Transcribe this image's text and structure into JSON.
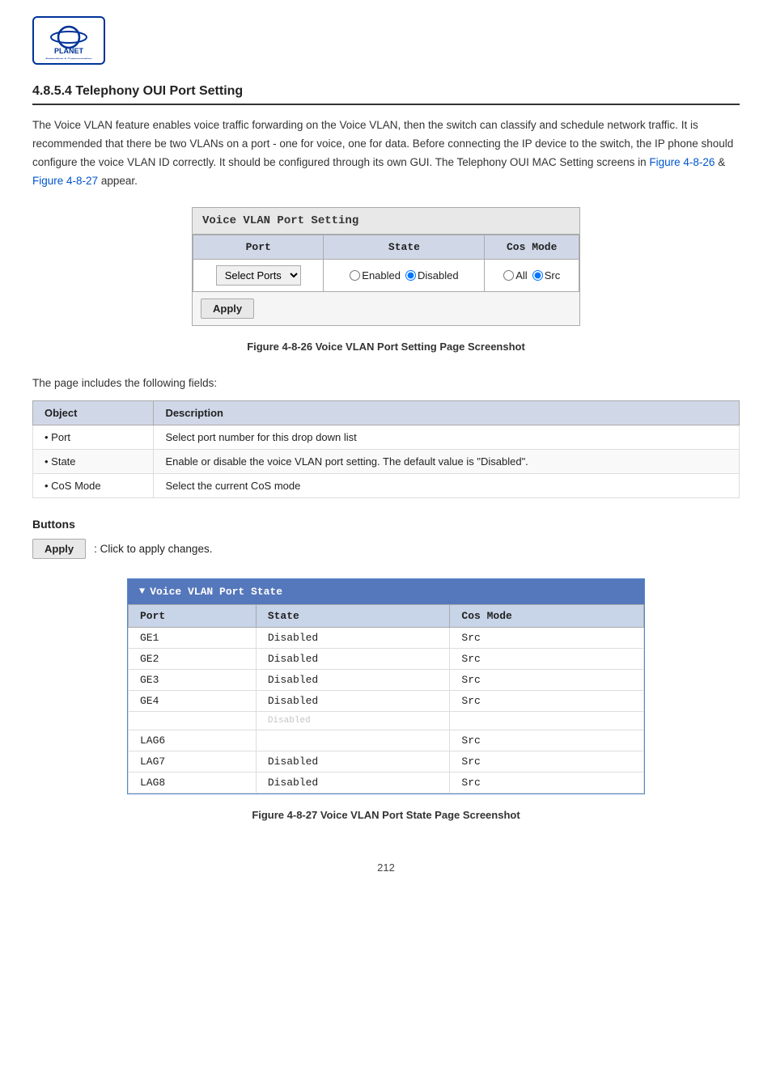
{
  "logo": {
    "brand": "PLANET",
    "sub": "Networking & Communication"
  },
  "section_title": "4.8.5.4 Telephony OUI Port Setting",
  "intro": {
    "text1": "The Voice VLAN feature enables voice traffic forwarding on the Voice VLAN, then the switch can classify and schedule network traffic. It is recommended that there be two VLANs on a port - one for voice, one for data. Before connecting the IP device to the switch, the IP phone should configure the voice VLAN ID correctly. It should be configured through its own GUI. The Telephony OUI MAC Setting screens in ",
    "link1": "Figure 4-8-26",
    "text2": " & ",
    "link2": "Figure 4-8-27",
    "text3": " appear."
  },
  "port_setting_box": {
    "title": "Voice VLAN Port Setting",
    "columns": [
      "Port",
      "State",
      "Cos Mode"
    ],
    "port_dropdown": {
      "value": "Select Ports",
      "placeholder": "Select Ports"
    },
    "state_options": [
      {
        "label": "Enabled",
        "checked": false
      },
      {
        "label": "Disabled",
        "checked": true
      }
    ],
    "cos_options": [
      {
        "label": "All",
        "checked": false
      },
      {
        "label": "Src",
        "checked": true
      }
    ],
    "apply_button": "Apply"
  },
  "figure1_caption": "Figure 4-8-26 Voice VLAN Port Setting Page Screenshot",
  "fields_intro": "The page includes the following fields:",
  "fields_table": {
    "headers": [
      "Object",
      "Description"
    ],
    "rows": [
      {
        "object": "Port",
        "description": "Select port number for this drop down list"
      },
      {
        "object": "State",
        "description": "Enable or disable the voice VLAN port setting. The default value is \"Disabled\"."
      },
      {
        "object": "CoS Mode",
        "description": "Select the current CoS mode"
      }
    ]
  },
  "buttons_section": {
    "title": "Buttons",
    "apply_label": "Apply",
    "apply_description": ": Click to apply changes."
  },
  "state_panel": {
    "title": "Voice VLAN Port State",
    "arrow": "▼",
    "columns": [
      "Port",
      "State",
      "Cos Mode"
    ],
    "rows": [
      {
        "port": "GE1",
        "state": "Disabled",
        "cos": "Src"
      },
      {
        "port": "GE2",
        "state": "Disabled",
        "cos": "Src"
      },
      {
        "port": "GE3",
        "state": "Disabled",
        "cos": "Src"
      },
      {
        "port": "GE4",
        "state": "Disabled",
        "cos": "Src"
      },
      {
        "port": "...",
        "state": "Disabled",
        "cos": "..."
      },
      {
        "port": "LAG6",
        "state": "",
        "cos": "Src"
      },
      {
        "port": "LAG7",
        "state": "Disabled",
        "cos": "Src"
      },
      {
        "port": "LAG8",
        "state": "Disabled",
        "cos": "Src"
      }
    ]
  },
  "figure2_caption": "Figure 4-8-27 Voice VLAN Port State Page Screenshot",
  "page_number": "212"
}
